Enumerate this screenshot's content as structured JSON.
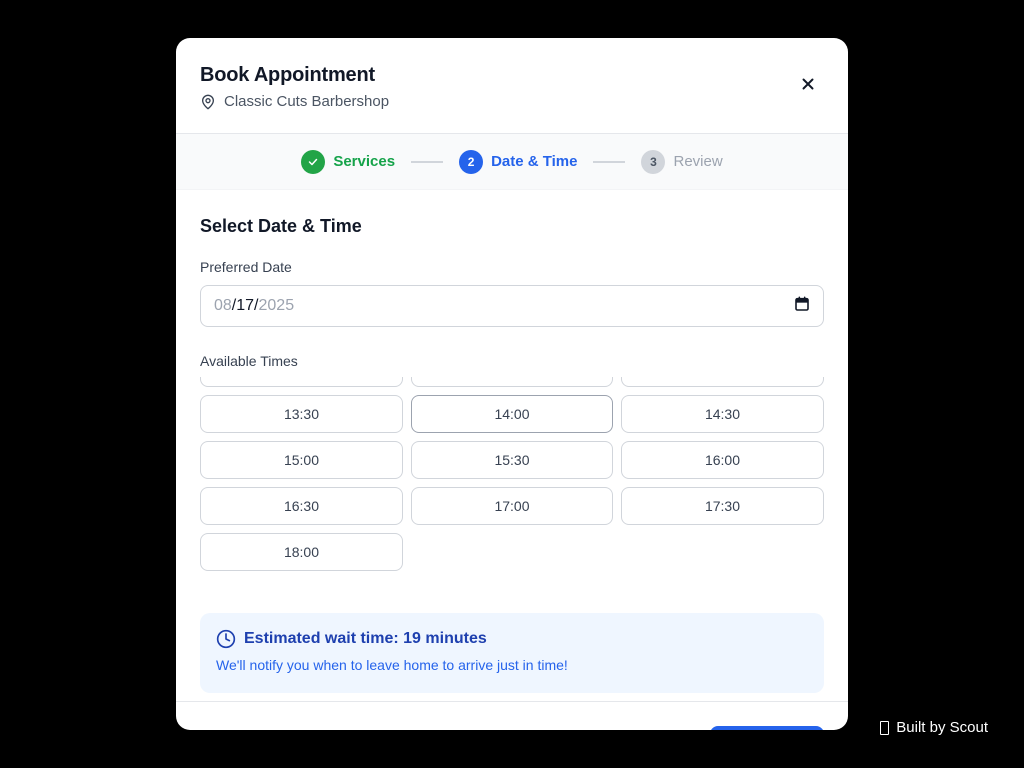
{
  "modal": {
    "title": "Book Appointment",
    "subtitle": "Classic Cuts Barbershop",
    "icons": {
      "location": "map-pin-icon",
      "close": "close-icon"
    }
  },
  "stepper": {
    "steps": [
      {
        "label": "Services",
        "marker": "",
        "state": "done",
        "icon": "check-icon"
      },
      {
        "label": "Date & Time",
        "marker": "2",
        "state": "active"
      },
      {
        "label": "Review",
        "marker": "3",
        "state": "todo"
      }
    ]
  },
  "date_time": {
    "section_title": "Select Date & Time",
    "date_label": "Preferred Date",
    "date_month": "08",
    "date_day": "17",
    "date_year": "2025",
    "date_sep": "/",
    "times_label": "Available Times",
    "times": [
      "",
      "",
      "",
      "13:30",
      "14:00",
      "14:30",
      "15:00",
      "15:30",
      "16:00",
      "16:30",
      "17:00",
      "17:30",
      "18:00"
    ]
  },
  "wait_info": {
    "title": "Estimated wait time: 19 minutes",
    "text": "We'll notify you when to leave home to arrive just in time!",
    "icon": "clock-icon"
  },
  "badge": {
    "text": "Built by Scout"
  },
  "colors": {
    "primary": "#2563eb",
    "success": "#22a447",
    "info_bg": "#eff6ff",
    "info_title": "#1e40af"
  }
}
